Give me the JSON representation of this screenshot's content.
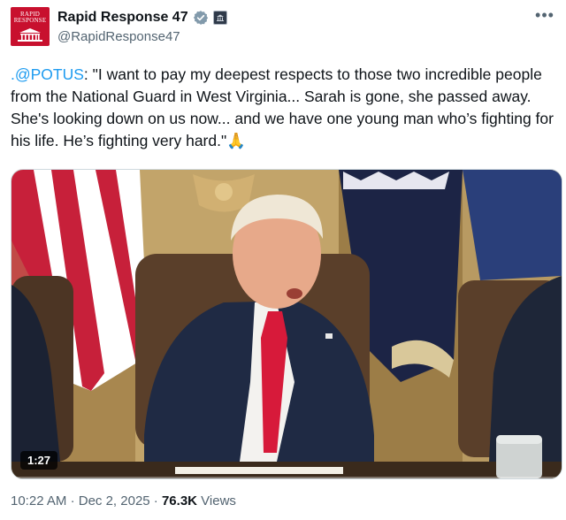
{
  "account": {
    "display_name": "Rapid Response 47",
    "handle": "@RapidResponse47",
    "avatar_text": "RAPID RESPONSE",
    "verified": true,
    "avatar_color": "#c8102e",
    "verified_color": "#829aab"
  },
  "header": {
    "more_label": "•••"
  },
  "tweet": {
    "mention": ".@POTUS",
    "text": ": \"I want to pay my deepest respects to those two incredible people from the National Guard in West Virginia... Sarah is gone, she passed away. She's looking down on us now... and we have one young man who’s fighting for his life. He’s fighting very hard.\"",
    "emoji": "🙏"
  },
  "media": {
    "duration": "1:27"
  },
  "meta": {
    "time": "10:22 AM",
    "separator": "·",
    "date": "Dec 2, 2025",
    "views_count": "76.3K",
    "views_label": "Views"
  },
  "colors": {
    "accent": "#1d9bf0",
    "secondary_text": "#536471"
  }
}
